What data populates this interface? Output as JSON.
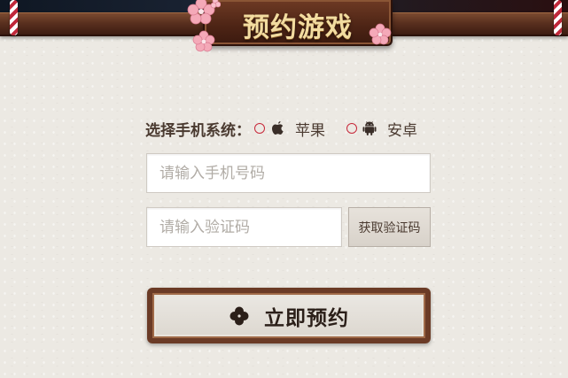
{
  "header": {
    "title": "预约游戏"
  },
  "form": {
    "os_label": "选择手机系统：",
    "os_options": [
      {
        "label": "苹果",
        "icon": "apple-icon",
        "selected": false
      },
      {
        "label": "安卓",
        "icon": "android-icon",
        "selected": false
      }
    ],
    "phone_placeholder": "请输入手机号码",
    "code_placeholder": "请输入验证码",
    "get_code_label": "获取验证码",
    "submit_label": "立即预约",
    "submit_icon": "clover-icon"
  },
  "colors": {
    "background": "#ece9e3",
    "wood_dark": "#4d2415",
    "title_gold": "#f2dca0",
    "radio_red": "#c7283a",
    "text_brown": "#4a3a30"
  }
}
